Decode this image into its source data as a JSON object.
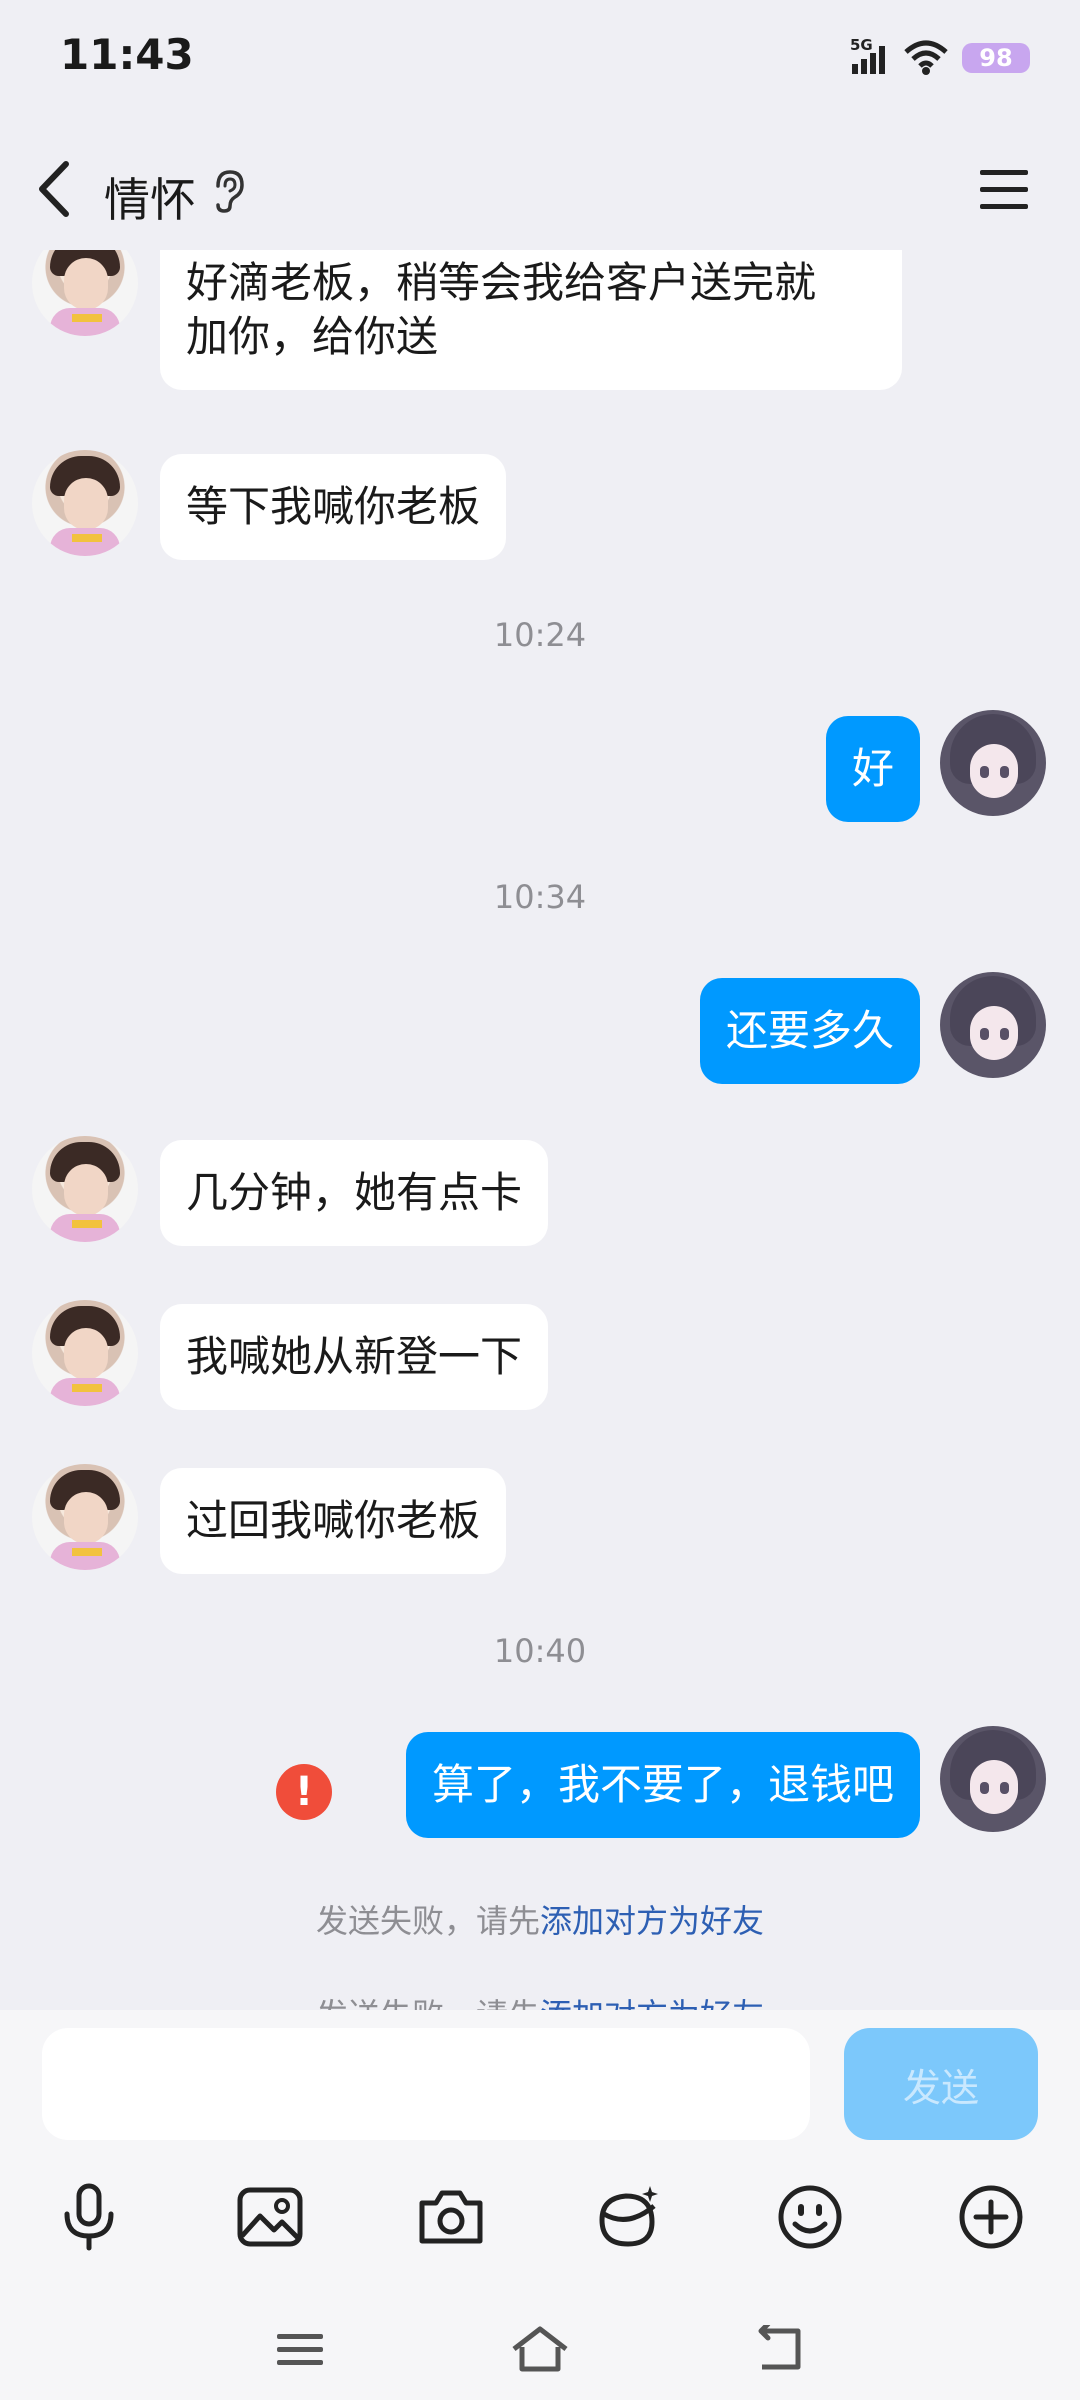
{
  "status_bar": {
    "time": "11:43",
    "network": "5G",
    "battery": "98"
  },
  "header": {
    "title": "情怀"
  },
  "messages": [
    {
      "direction": "incoming",
      "text_lines": [
        "好滴老板，稍等会我给客户送完就",
        "加你，给你送"
      ]
    },
    {
      "direction": "incoming",
      "text": "等下我喊你老板"
    },
    {
      "type": "time",
      "text": "10:24"
    },
    {
      "direction": "outgoing",
      "text": "好"
    },
    {
      "type": "time",
      "text": "10:34"
    },
    {
      "direction": "outgoing",
      "text": "还要多久"
    },
    {
      "direction": "incoming",
      "text": "几分钟，她有点卡"
    },
    {
      "direction": "incoming",
      "text": "我喊她从新登一下"
    },
    {
      "direction": "incoming",
      "text": "过回我喊你老板"
    },
    {
      "type": "time",
      "text": "10:40"
    },
    {
      "direction": "outgoing",
      "text": "算了，我不要了，退钱吧",
      "failed": true,
      "error_mark": "!"
    }
  ],
  "notices": [
    {
      "prefix": "发送失败，请先",
      "link": "添加对方为好友"
    },
    {
      "prefix": "发送失败，请先",
      "link": "添加对方为好友"
    }
  ],
  "input": {
    "value": "",
    "send_label": "发送"
  },
  "toolbar": [
    "microphone-icon",
    "image-icon",
    "camera-icon",
    "red-packet-icon",
    "emoji-icon",
    "plus-icon"
  ],
  "nav": [
    "menu-icon",
    "home-icon",
    "back-icon"
  ],
  "colors": {
    "accent": "#0099ff",
    "error": "#f04d3a",
    "link": "#2d5fb3",
    "send_disabled": "#7cc8fb"
  }
}
